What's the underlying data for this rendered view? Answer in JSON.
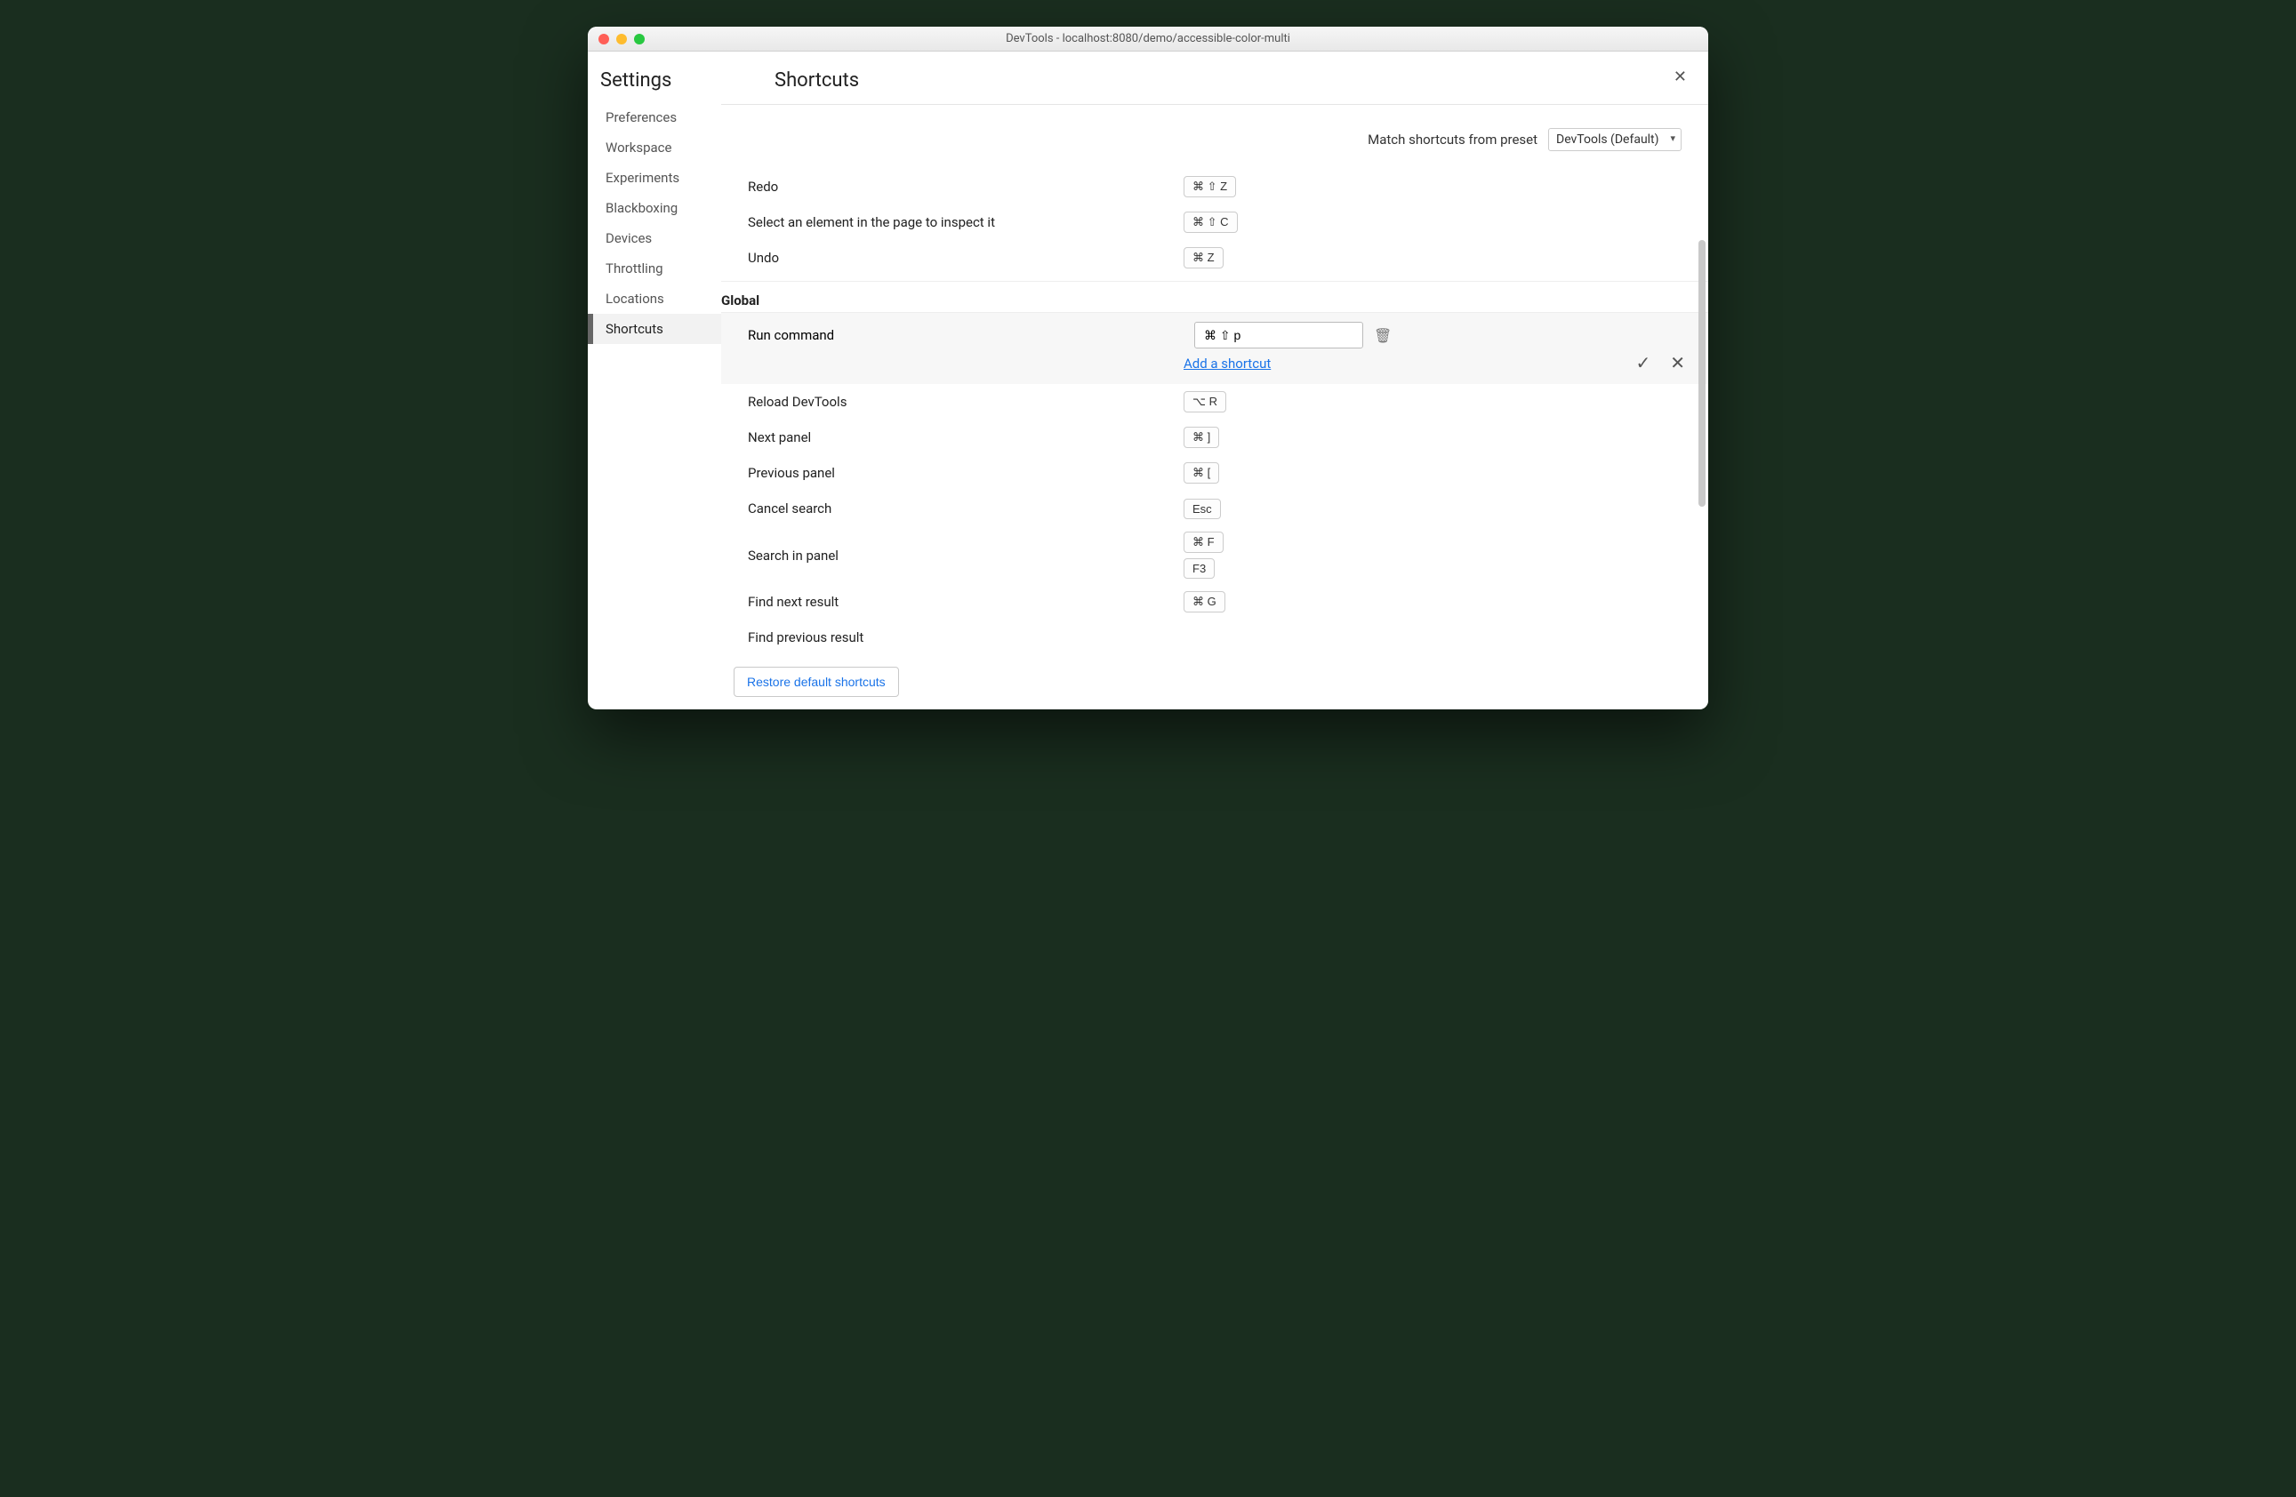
{
  "window_title": "DevTools - localhost:8080/demo/accessible-color-multi",
  "settings_label": "Settings",
  "nav": [
    "Preferences",
    "Workspace",
    "Experiments",
    "Blackboxing",
    "Devices",
    "Throttling",
    "Locations",
    "Shortcuts"
  ],
  "nav_active": "Shortcuts",
  "page_title": "Shortcuts",
  "preset_label": "Match shortcuts from preset",
  "preset_value": "DevTools (Default)",
  "top_rows": [
    {
      "label": "Redo",
      "keys": [
        "⌘ ⇧ Z"
      ]
    },
    {
      "label": "Select an element in the page to inspect it",
      "keys": [
        "⌘ ⇧ C"
      ]
    },
    {
      "label": "Undo",
      "keys": [
        "⌘ Z"
      ]
    }
  ],
  "section": "Global",
  "edit": {
    "label": "Run command",
    "value": "⌘ ⇧ p",
    "add_label": "Add a shortcut"
  },
  "global_rows": [
    {
      "label": "Reload DevTools",
      "keys": [
        "⌥ R"
      ]
    },
    {
      "label": "Next panel",
      "keys": [
        "⌘ ]"
      ]
    },
    {
      "label": "Previous panel",
      "keys": [
        "⌘ ["
      ]
    },
    {
      "label": "Cancel search",
      "keys": [
        "Esc"
      ]
    },
    {
      "label": "Search in panel",
      "keys": [
        "⌘ F",
        "F3"
      ]
    },
    {
      "label": "Find next result",
      "keys": [
        "⌘ G"
      ]
    },
    {
      "label": "Find previous result",
      "keys": []
    }
  ],
  "restore_label": "Restore default shortcuts"
}
